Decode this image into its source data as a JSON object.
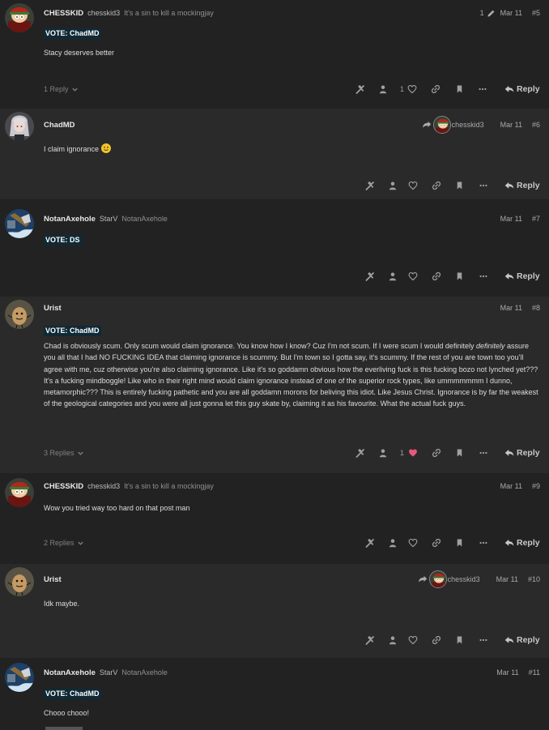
{
  "posts": [
    {
      "username": "CHESSKID",
      "handle": "chesskid3",
      "title": "It's a sin to kill a mockingjay",
      "edit_count": "1",
      "date": "Mar 11",
      "number": "#5",
      "vote": "VOTE: ChadMD",
      "text": "Stacy deserves better",
      "replies": "1 Reply",
      "likes": "1",
      "liked": false,
      "reply_label": "Reply"
    },
    {
      "username": "ChadMD",
      "reply_to": "chesskid3",
      "date": "Mar 11",
      "number": "#6",
      "text": "I claim ignorance",
      "emoji": "slightly-smiling-face",
      "reply_label": "Reply"
    },
    {
      "username": "NotanAxehole",
      "handle": "StarV",
      "title": "NotanAxehole",
      "date": "Mar 11",
      "number": "#7",
      "vote": "VOTE: DS",
      "reply_label": "Reply"
    },
    {
      "username": "Urist",
      "date": "Mar 11",
      "number": "#8",
      "vote": "VOTE: ChadMD",
      "text_before_em": "Chad is obviously scum. Only scum would claim ignorance. You know how I know? Cuz I'm not scum. If I were scum I would definitely ",
      "text_em": "definitely",
      "text_after_em": " assure you all that I had NO FUCKING IDEA that claiming ignorance is scummy. But I'm town so I gotta say, it's scummy. If the rest of you are town too you'll agree with me, cuz otherwise you're also claiming ignorance. Like it's so goddamn obvious how the everliving fuck is this fucking bozo not lynched yet??? It's a fucking mindboggle! Like who in their right mind would claim ignorance instead of one of the superior rock types, like ummmmmmm I dunno, metamorphic??? This is entirely fucking pathetic and you are all goddamn morons for beliving this idiot. Like Jesus Christ. Ignorance is by far the weakest of the geological categories and you were all just gonna let this guy skate by, claiming it as his favourite. What the actual fuck guys.",
      "replies": "3 Replies",
      "likes": "1",
      "liked": true,
      "reply_label": "Reply"
    },
    {
      "username": "CHESSKID",
      "handle": "chesskid3",
      "title": "It's a sin to kill a mockingjay",
      "date": "Mar 11",
      "number": "#9",
      "text": "Wow you tried way too hard on that post man",
      "replies": "2 Replies",
      "reply_label": "Reply"
    },
    {
      "username": "Urist",
      "reply_to": "chesskid3",
      "date": "Mar 11",
      "number": "#10",
      "text": "Idk maybe.",
      "reply_label": "Reply"
    },
    {
      "username": "NotanAxehole",
      "handle": "StarV",
      "title": "NotanAxehole",
      "date": "Mar 11",
      "number": "#11",
      "vote": "VOTE: ChadMD",
      "text": "Chooo chooo!"
    }
  ],
  "icons": {
    "edit": "pencil-icon",
    "reply_to": "share-arrow-icon",
    "replies_toggle": "chevron-down-icon",
    "admin": "wrench-icon",
    "author": "user-icon",
    "like": "heart-icon",
    "link": "link-icon",
    "bookmark": "bookmark-icon",
    "more": "ellipsis-icon",
    "reply": "reply-arrow-icon"
  },
  "colors": {
    "background": "#222222",
    "post_alt_background": "#2a2a2a",
    "vote_background": "#0f2a36",
    "liked_heart": "#e45a7a",
    "emoji": "#f2c52a"
  }
}
